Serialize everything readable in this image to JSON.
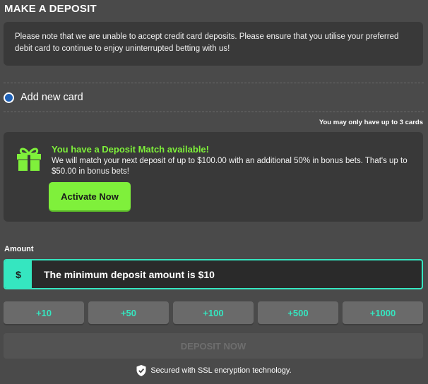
{
  "page": {
    "title": "MAKE A DEPOSIT"
  },
  "notice": {
    "text": "Please note that we are unable to accept credit card deposits. Please ensure that you utilise your preferred debit card to continue to enjoy uninterrupted betting with us!"
  },
  "card": {
    "add_label": "Add new card",
    "limit_note": "You may only have up to 3 cards"
  },
  "promo": {
    "title": "You have a Deposit Match available!",
    "text": "We will match your next deposit of up to $100.00 with an additional 50% in bonus bets. That's up to $50.00 in bonus bets!",
    "button_label": "Activate Now",
    "icon": "gift-icon"
  },
  "amount": {
    "label": "Amount",
    "currency_symbol": "$",
    "placeholder": "The minimum deposit amount is $10",
    "value": ""
  },
  "quick_amounts": [
    "+10",
    "+50",
    "+100",
    "+500",
    "+1000"
  ],
  "deposit_button": {
    "label": "DEPOSIT NOW",
    "enabled": false
  },
  "security": {
    "text": "Secured with SSL encryption technology.",
    "icon": "shield-icon"
  },
  "colors": {
    "background": "#4a4a4a",
    "panel": "#393939",
    "accent_green": "#7ff03b",
    "accent_teal": "#35e6c0",
    "radio_blue": "#1f62b8"
  }
}
